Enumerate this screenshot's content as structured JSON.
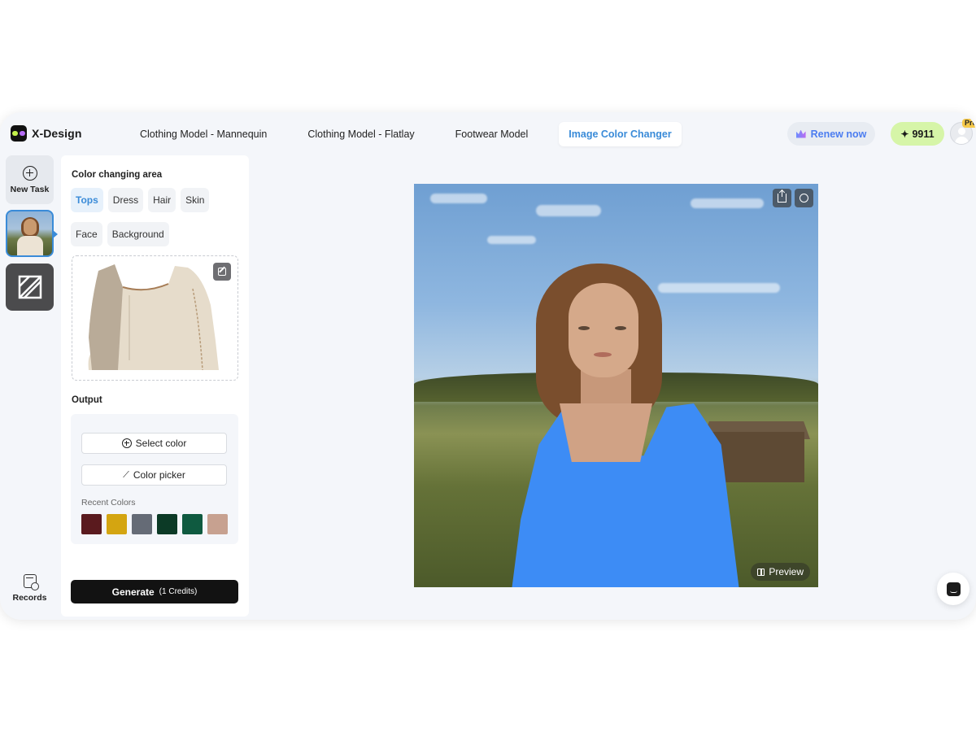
{
  "app": {
    "name": "X-Design",
    "tabs": [
      {
        "label": "Clothing Model - Mannequin"
      },
      {
        "label": "Clothing Model - Flatlay"
      },
      {
        "label": "Footwear Model"
      },
      {
        "label": "Image Color Changer"
      }
    ],
    "active_tab": "Image Color Changer",
    "renew_label": "Renew now",
    "credit_balance": "9911",
    "pro_badge": "Pro"
  },
  "sidebar": {
    "new_task_label": "New Task",
    "records_label": "Records"
  },
  "panel": {
    "area_title": "Color changing area",
    "areas": [
      "Tops",
      "Dress",
      "Hair",
      "Skin",
      "Face",
      "Background"
    ],
    "selected_area": "Tops",
    "output_title": "Output",
    "select_color_label": "Select color",
    "color_picker_label": "Color picker",
    "recent_colors_label": "Recent Colors",
    "recent_colors": [
      "#5a1a1e",
      "#d4a511",
      "#656b76",
      "#0c3a26",
      "#0f5a40",
      "#c7a190"
    ],
    "generate_label": "Generate",
    "generate_credits": "(1 Credits)"
  },
  "canvas": {
    "preview_label": "Preview",
    "recolor_color": "#3d8cf5"
  },
  "icons": {
    "logo": "x-design-logo",
    "new_task": "plus-circle-icon",
    "records": "calendar-clock-icon",
    "edit": "edit-icon",
    "upload": "upload-icon",
    "feedback": "feedback-icon",
    "compare": "compare-icon",
    "chat": "chat-icon"
  },
  "colors": {
    "accent": "#3a8bd8",
    "credits_bg": "#d6f5a8",
    "generate_bg": "#121212"
  }
}
